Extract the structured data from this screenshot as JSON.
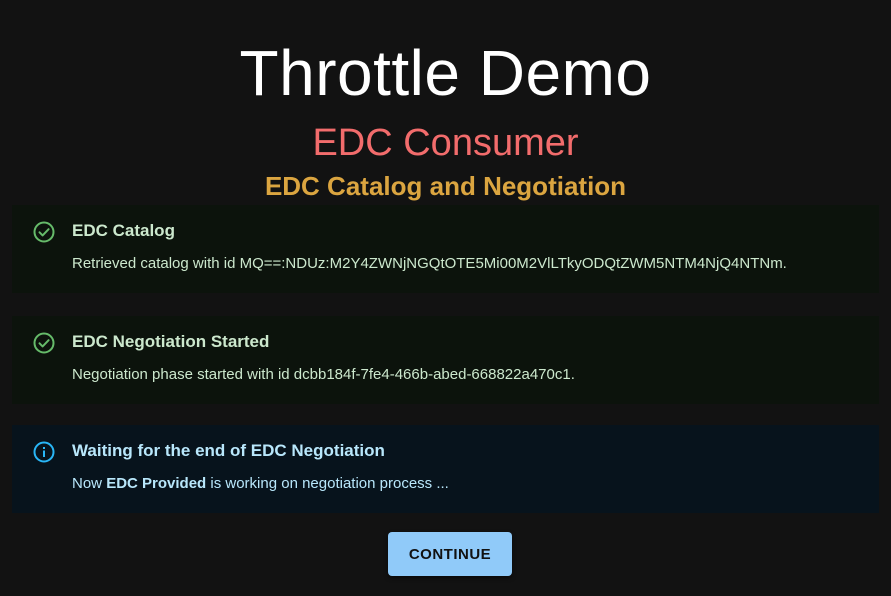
{
  "header": {
    "title": "Throttle Demo",
    "subtitle": "EDC Consumer",
    "section_title": "EDC Catalog and Negotiation"
  },
  "alerts": [
    {
      "severity": "success",
      "icon": "check-circle-icon",
      "title": "EDC Catalog",
      "text": "Retrieved catalog with id MQ==:NDUz:M2Y4ZWNjNGQtOTE5Mi00M2VlLTkyODQtZWM5NTM4NjQ4NTNm."
    },
    {
      "severity": "success",
      "icon": "check-circle-icon",
      "title": "EDC Negotiation Started",
      "text": "Negotiation phase started with id dcbb184f-7fe4-466b-abed-668822a470c1."
    },
    {
      "severity": "info",
      "icon": "info-circle-icon",
      "title": "Waiting for the end of EDC Negotiation",
      "text_prefix": "Now ",
      "text_bold": "EDC Provided",
      "text_suffix": " is working on negotiation process ..."
    }
  ],
  "actions": {
    "continue_label": "CONTINUE"
  },
  "colors": {
    "background": "#121212",
    "title": "#ffffff",
    "subtitle": "#f26c6c",
    "section_title": "#dba540",
    "success_icon": "#66bb6a",
    "info_icon": "#29b6f6",
    "button": "#90caf9"
  }
}
